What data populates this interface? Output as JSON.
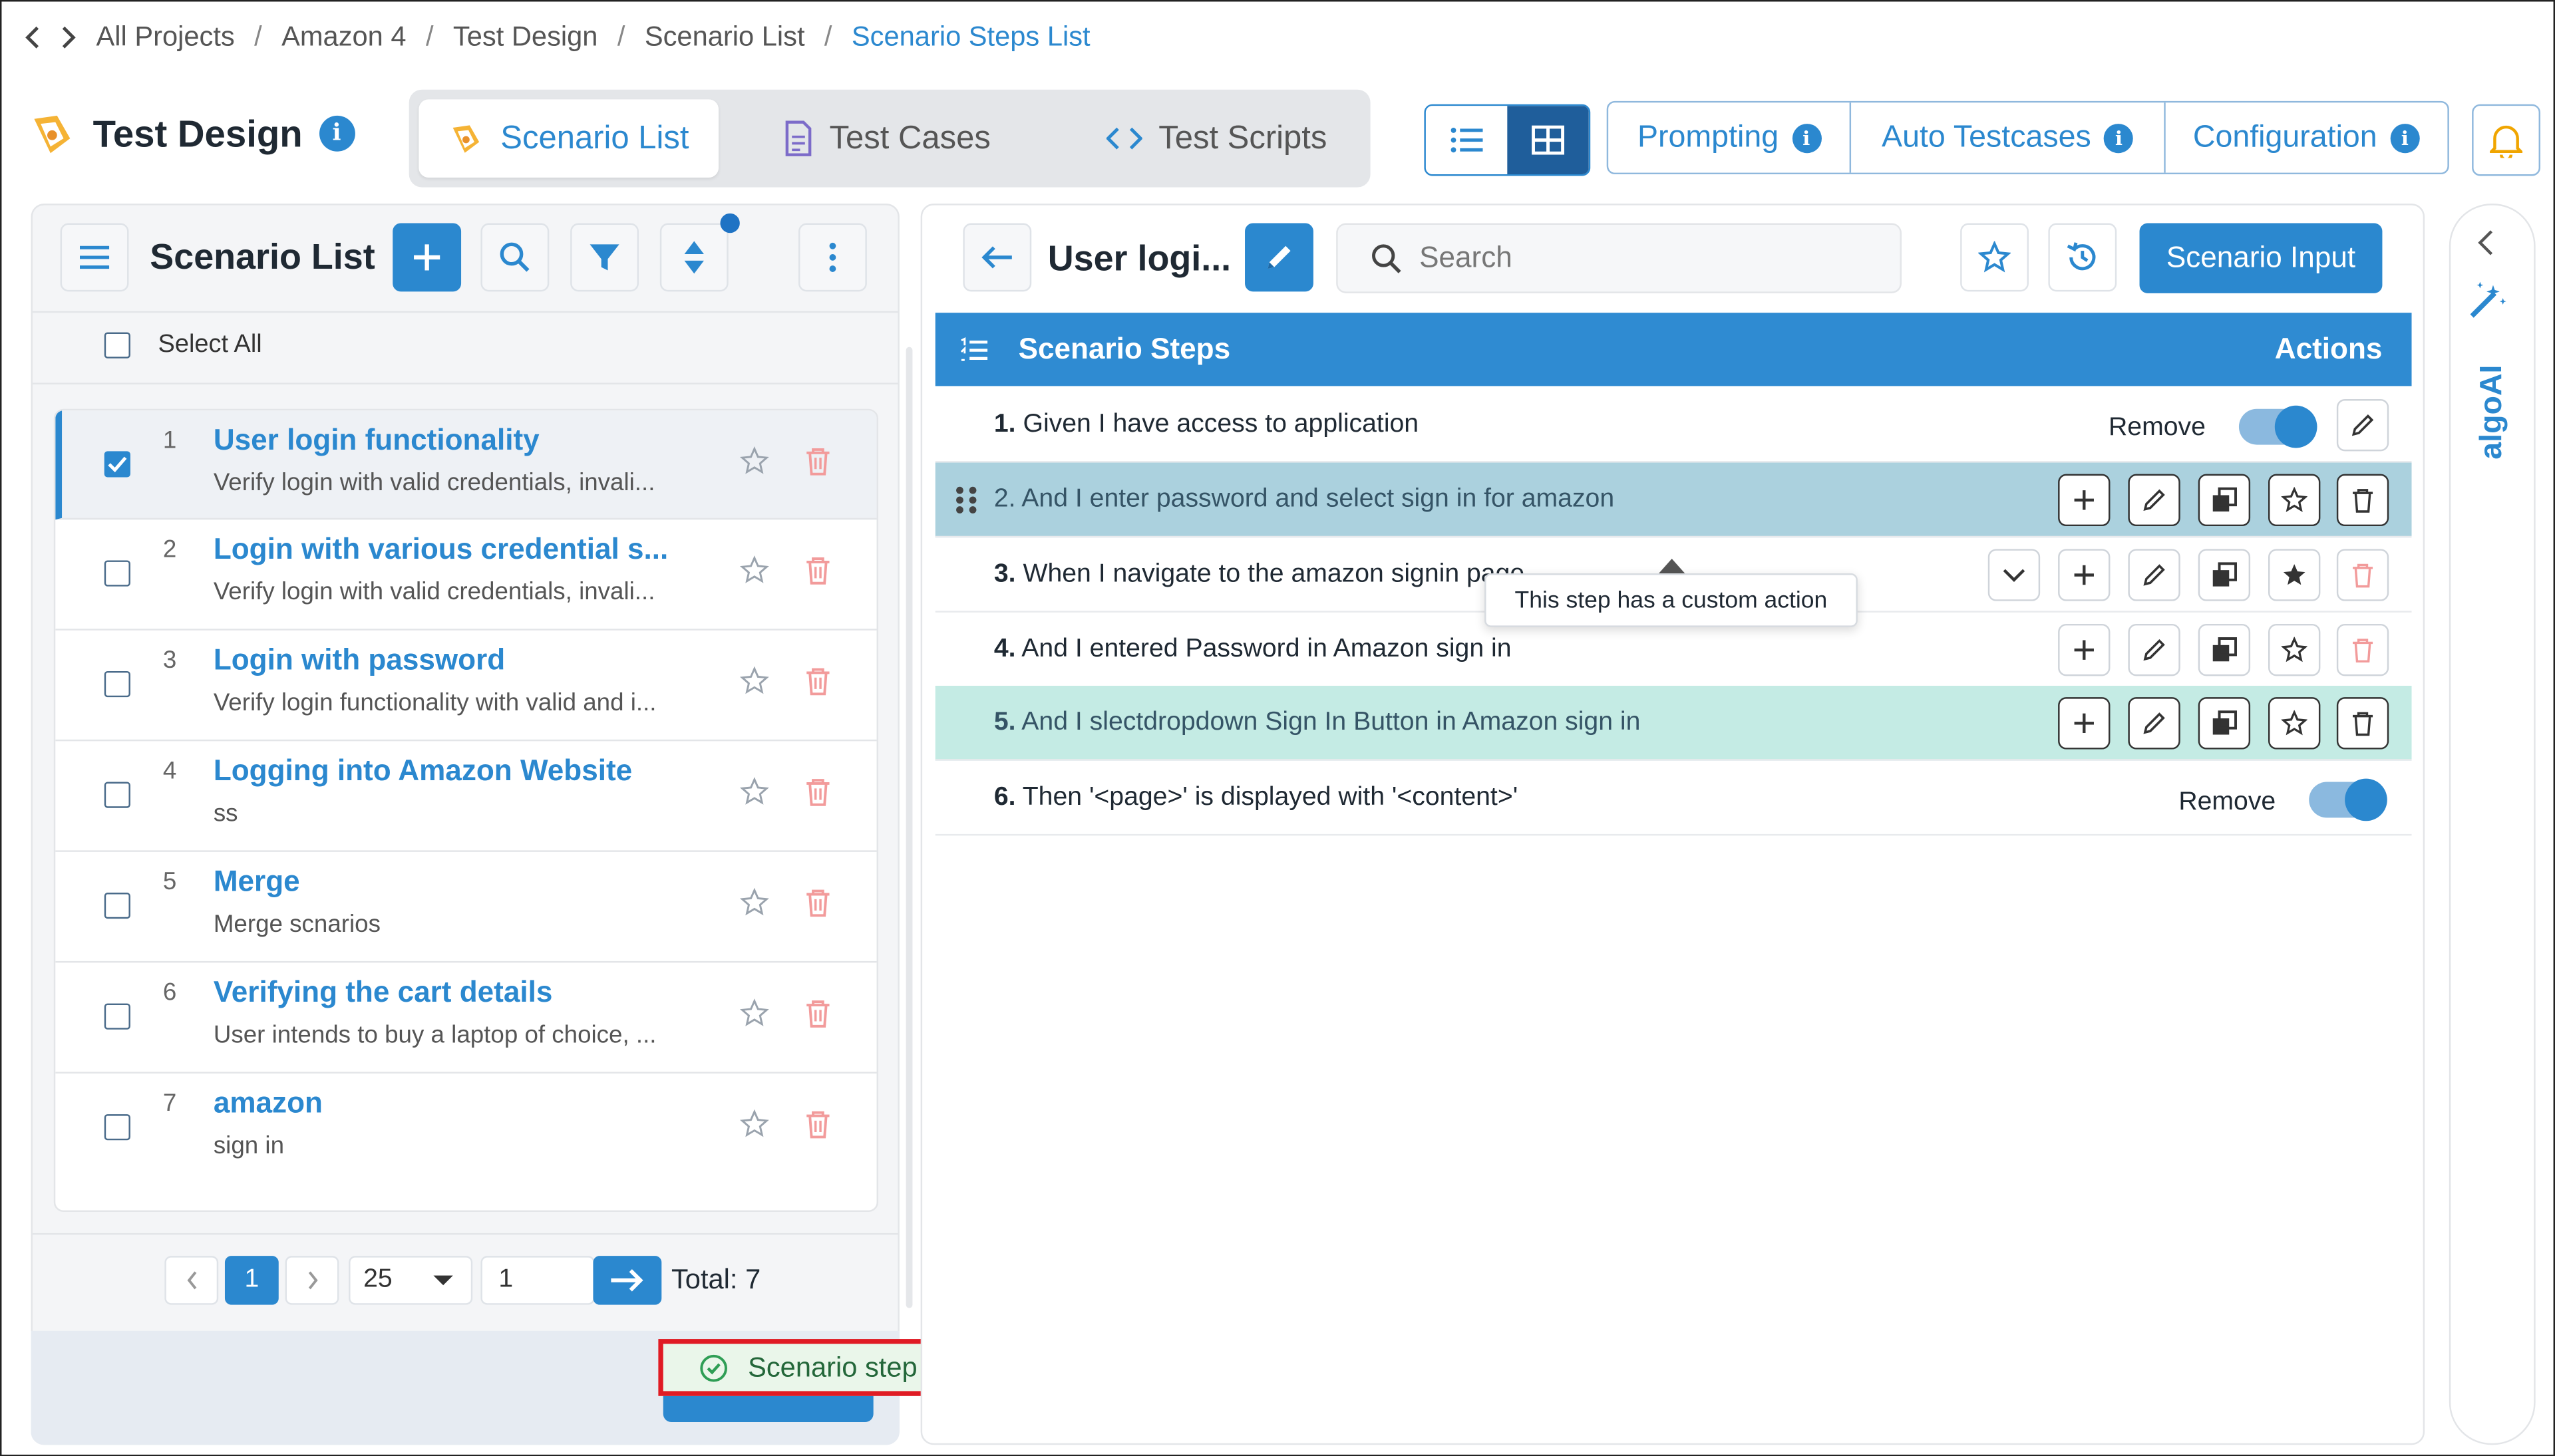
{
  "breadcrumb": {
    "items": [
      "All Projects",
      "Amazon 4",
      "Test Design",
      "Scenario List"
    ],
    "current": "Scenario Steps List"
  },
  "header": {
    "title": "Test Design",
    "tabs": [
      {
        "label": "Scenario List",
        "active": true
      },
      {
        "label": "Test Cases",
        "active": false
      },
      {
        "label": "Test Scripts",
        "active": false
      }
    ],
    "actions": [
      "Prompting",
      "Auto Testcases",
      "Configuration"
    ]
  },
  "left": {
    "title": "Scenario List",
    "select_all": "Select All",
    "items": [
      {
        "num": "1",
        "title": "User login functionality",
        "sub": "Verify login with valid credentials, invali...",
        "checked": true
      },
      {
        "num": "2",
        "title": "Login with various credential s...",
        "sub": "Verify login with valid credentials, invali...",
        "checked": false
      },
      {
        "num": "3",
        "title": "Login with password",
        "sub": "Verify login functionality with valid and i...",
        "checked": false
      },
      {
        "num": "4",
        "title": "Logging into Amazon Website",
        "sub": "ss",
        "checked": false
      },
      {
        "num": "5",
        "title": "Merge",
        "sub": "Merge scnarios",
        "checked": false
      },
      {
        "num": "6",
        "title": "Verifying the cart details",
        "sub": "User intends to buy a laptop of choice, ...",
        "checked": false
      },
      {
        "num": "7",
        "title": "amazon",
        "sub": "sign in",
        "checked": false
      }
    ],
    "pagination": {
      "page": "1",
      "page_size": "25",
      "goto": "1",
      "total": "Total: 7"
    }
  },
  "right": {
    "title": "User logi...",
    "search_placeholder": "Search",
    "scenario_input": "Scenario Input",
    "steps_header": "Scenario Steps",
    "actions_header": "Actions",
    "remove_label": "Remove",
    "steps": [
      {
        "num": "1.",
        "text": "Given I have access to application"
      },
      {
        "num": "2.",
        "text": "And I enter password and select sign in for amazon"
      },
      {
        "num": "3.",
        "text": "When I navigate to the amazon signin page"
      },
      {
        "num": "4.",
        "text": "And I entered Password in Amazon sign in"
      },
      {
        "num": "5.",
        "text": "And I slectdropdown Sign In Button in Amazon sign in"
      },
      {
        "num": "6.",
        "text": "Then '<page>' is displayed with '<content>'"
      }
    ],
    "tooltip": "This step has a custom action"
  },
  "rail": {
    "label": "algoAI"
  },
  "toast": {
    "message": "Scenario step updated successfully."
  },
  "colors": {
    "accent": "#2b88cf",
    "step_selected": "#abd1de",
    "step_highlight": "#c4ebe4",
    "toast_border": "#e01b24"
  }
}
